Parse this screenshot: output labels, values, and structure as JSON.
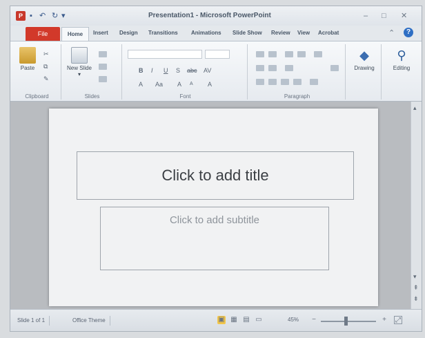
{
  "window": {
    "title": "Presentation1 - Microsoft PowerPoint",
    "app_icon": "P",
    "min": "–",
    "max": "□",
    "close": "✕"
  },
  "qat": {
    "save": "▪",
    "undo": "↶",
    "redo": "↻",
    "customize": "▾"
  },
  "tabs": {
    "file": "File",
    "home": "Home",
    "insert": "Insert",
    "design": "Design",
    "transitions": "Transitions",
    "animations": "Animations",
    "slideshow": "Slide Show",
    "review": "Review",
    "view": "View",
    "acrobat": "Acrobat",
    "help": "?"
  },
  "ribbon": {
    "clipboard": {
      "label": "Clipboard",
      "paste": "Paste"
    },
    "slides": {
      "label": "Slides",
      "new_slide": "New Slide ▾"
    },
    "font": {
      "label": "Font",
      "bold": "B",
      "italic": "I",
      "underline": "U",
      "strike": "S",
      "abc": "abc",
      "av": "AV",
      "grow": "A",
      "shrink": "A",
      "clear": "A",
      "color": "A"
    },
    "paragraph": {
      "label": "Paragraph"
    },
    "drawing": {
      "label": "Drawing"
    },
    "editing": {
      "label": "Editing"
    }
  },
  "slide": {
    "title_placeholder": "Click to add title",
    "subtitle_placeholder": "Click to add subtitle"
  },
  "status": {
    "slide_count": "Slide 1 of 1",
    "theme": "Office Theme",
    "zoom": "45%",
    "zoom_level": 0.45
  },
  "colors": {
    "file_tab": "#d2392a",
    "accent": "#2f6fc4"
  }
}
